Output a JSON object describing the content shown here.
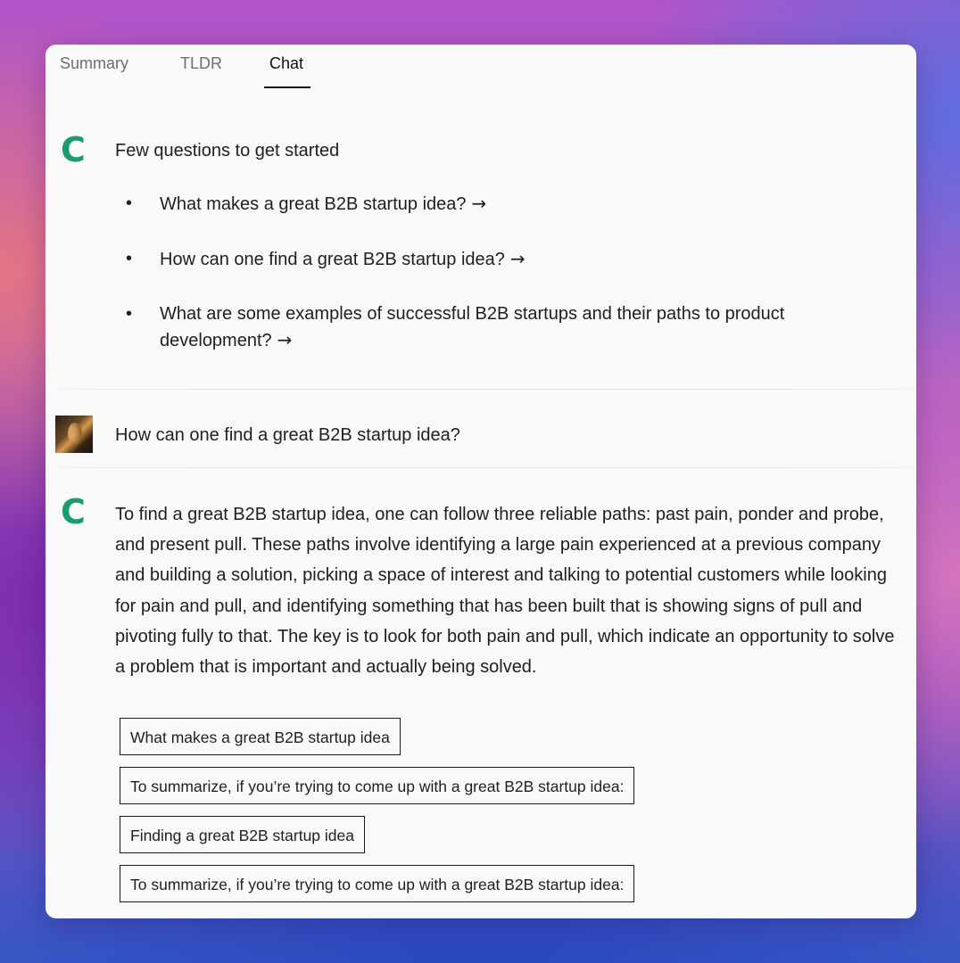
{
  "tabs": [
    {
      "label": "Summary",
      "active": false
    },
    {
      "label": "TLDR",
      "active": false
    },
    {
      "label": "Chat",
      "active": true
    }
  ],
  "assistant_icon": {
    "glyph": "C",
    "color": "#1e9a72"
  },
  "intro": {
    "title": "Few questions to get started",
    "questions": [
      "What makes a great B2B startup idea?",
      "How can one find a great B2B startup idea?",
      "What are some examples of successful B2B startups and their paths to product development?"
    ],
    "arrow_icon": "arrow-right-icon"
  },
  "user_message": {
    "text": "How can one find a great B2B startup idea?",
    "avatar": "user-avatar"
  },
  "assistant_answer": {
    "text": "To find a great B2B startup idea, one can follow three reliable paths: past pain, ponder and probe, and present pull. These paths involve identifying a large pain experienced at a previous company and building a solution, picking a space of interest and talking to potential customers while looking for pain and pull, and identifying something that has been built that is showing signs of pull and pivoting fully to that. The key is to look for both pain and pull, which indicate an opportunity to solve a problem that is important and actually being solved.",
    "sources": [
      "What makes a great B2B startup idea",
      "To summarize, if you’re trying to come up with a great B2B startup idea:",
      "Finding a great B2B startup idea",
      "To summarize, if you’re trying to come up with a great B2B startup idea:"
    ]
  }
}
